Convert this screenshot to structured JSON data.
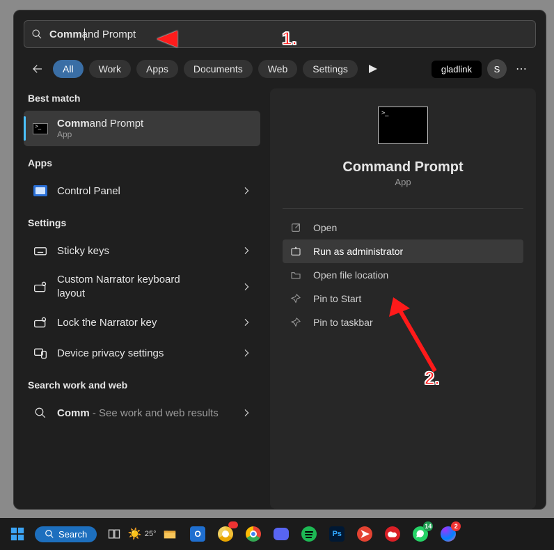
{
  "search": {
    "typed_bold": "Comm",
    "typed_rest": "and Prompt"
  },
  "tabs": {
    "items": [
      "All",
      "Work",
      "Apps",
      "Documents",
      "Web",
      "Settings"
    ],
    "extra_label": "gladlink",
    "avatar_initial": "S"
  },
  "left": {
    "best_match_head": "Best match",
    "best_match": {
      "title_bold": "Comm",
      "title_rest": "and Prompt",
      "sub": "App"
    },
    "apps_head": "Apps",
    "apps": [
      {
        "label": "Control Panel"
      }
    ],
    "settings_head": "Settings",
    "settings": [
      {
        "label": "Sticky keys"
      },
      {
        "label": "Custom Narrator keyboard layout"
      },
      {
        "label": "Lock the Narrator key"
      },
      {
        "label": "Device privacy settings"
      }
    ],
    "web_head": "Search work and web",
    "web": {
      "label_bold": "Comm",
      "label_rest": " - See work and web results"
    }
  },
  "right": {
    "title": "Command Prompt",
    "type": "App",
    "actions": [
      {
        "label": "Open"
      },
      {
        "label": "Run as administrator"
      },
      {
        "label": "Open file location"
      },
      {
        "label": "Pin to Start"
      },
      {
        "label": "Pin to taskbar"
      }
    ]
  },
  "annotations": {
    "one": "1.",
    "two": "2."
  },
  "taskbar": {
    "search_label": "Search",
    "temperature": "25°",
    "messenger_badge": "2",
    "whatsapp_badge": "14"
  }
}
